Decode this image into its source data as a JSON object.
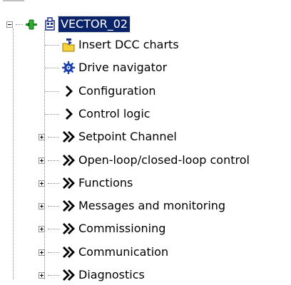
{
  "root": {
    "label": "VECTOR_02",
    "expanded": true
  },
  "items": [
    {
      "label": "Insert DCC charts",
      "icon": "insert-dcc-chart-icon",
      "expandable": false
    },
    {
      "label": "Drive navigator",
      "icon": "drive-navigator-icon",
      "expandable": false
    },
    {
      "label": "Configuration",
      "icon": "chevron-right-icon",
      "expandable": false
    },
    {
      "label": "Control logic",
      "icon": "chevron-right-icon",
      "expandable": false
    },
    {
      "label": "Setpoint Channel",
      "icon": "double-chevron-right-icon",
      "expandable": true
    },
    {
      "label": "Open-loop/closed-loop control",
      "icon": "double-chevron-right-icon",
      "expandable": true
    },
    {
      "label": "Functions",
      "icon": "double-chevron-right-icon",
      "expandable": true
    },
    {
      "label": "Messages and monitoring",
      "icon": "double-chevron-right-icon",
      "expandable": true
    },
    {
      "label": "Commissioning",
      "icon": "double-chevron-right-icon",
      "expandable": true
    },
    {
      "label": "Communication",
      "icon": "double-chevron-right-icon",
      "expandable": true
    },
    {
      "label": "Diagnostics",
      "icon": "double-chevron-right-icon",
      "expandable": true
    }
  ]
}
